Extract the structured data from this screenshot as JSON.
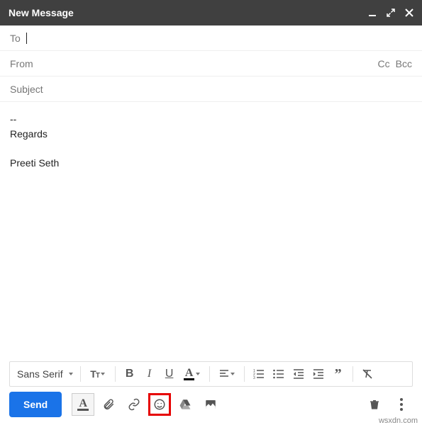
{
  "header": {
    "title": "New Message"
  },
  "fields": {
    "to_label": "To",
    "from_label": "From",
    "cc_label": "Cc",
    "bcc_label": "Bcc",
    "subject_placeholder": "Subject"
  },
  "body": {
    "separator": "--",
    "line1": "Regards",
    "line2": "Preeti Seth"
  },
  "format": {
    "font_name": "Sans Serif"
  },
  "actions": {
    "send_label": "Send"
  },
  "watermark": "wsxdn.com"
}
